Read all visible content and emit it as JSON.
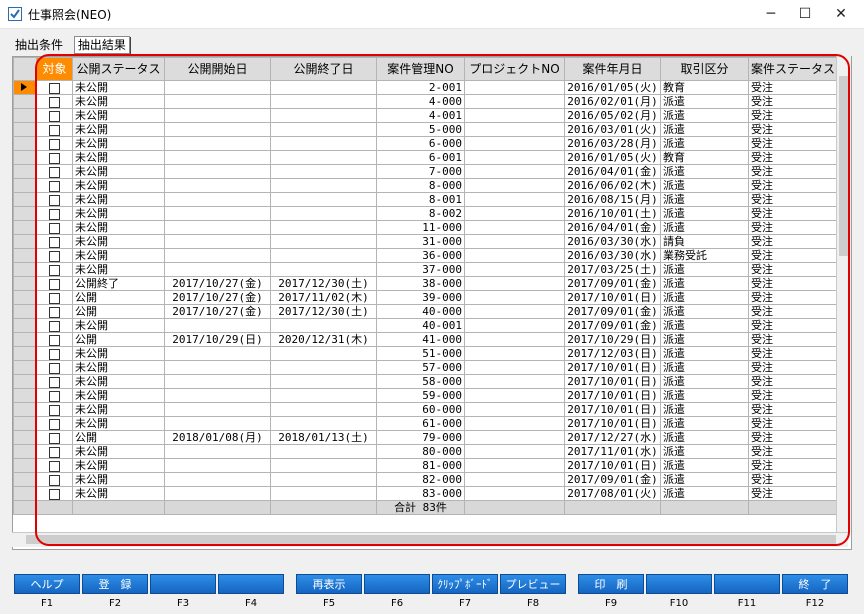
{
  "window": {
    "title": "仕事照会(NEO)",
    "minimize": "─",
    "maximize": "☐",
    "close": "✕"
  },
  "tabs": [
    "抽出条件",
    "抽出結果"
  ],
  "grid": {
    "columns": [
      "対象",
      "公開ステータス",
      "公開開始日",
      "公開終了日",
      "案件管理NO",
      "プロジェクトNO",
      "案件年月日",
      "取引区分",
      "案件ステータス"
    ],
    "rows": [
      [
        "未公開",
        "",
        "",
        "2-001",
        "",
        "2016/01/05(火)",
        "教育",
        "受注"
      ],
      [
        "未公開",
        "",
        "",
        "4-000",
        "",
        "2016/02/01(月)",
        "派遣",
        "受注"
      ],
      [
        "未公開",
        "",
        "",
        "4-001",
        "",
        "2016/05/02(月)",
        "派遣",
        "受注"
      ],
      [
        "未公開",
        "",
        "",
        "5-000",
        "",
        "2016/03/01(火)",
        "派遣",
        "受注"
      ],
      [
        "未公開",
        "",
        "",
        "6-000",
        "",
        "2016/03/28(月)",
        "派遣",
        "受注"
      ],
      [
        "未公開",
        "",
        "",
        "6-001",
        "",
        "2016/01/05(火)",
        "教育",
        "受注"
      ],
      [
        "未公開",
        "",
        "",
        "7-000",
        "",
        "2016/04/01(金)",
        "派遣",
        "受注"
      ],
      [
        "未公開",
        "",
        "",
        "8-000",
        "",
        "2016/06/02(木)",
        "派遣",
        "受注"
      ],
      [
        "未公開",
        "",
        "",
        "8-001",
        "",
        "2016/08/15(月)",
        "派遣",
        "受注"
      ],
      [
        "未公開",
        "",
        "",
        "8-002",
        "",
        "2016/10/01(土)",
        "派遣",
        "受注"
      ],
      [
        "未公開",
        "",
        "",
        "11-000",
        "",
        "2016/04/01(金)",
        "派遣",
        "受注"
      ],
      [
        "未公開",
        "",
        "",
        "31-000",
        "",
        "2016/03/30(水)",
        "請負",
        "受注"
      ],
      [
        "未公開",
        "",
        "",
        "36-000",
        "",
        "2016/03/30(水)",
        "業務受託",
        "受注"
      ],
      [
        "未公開",
        "",
        "",
        "37-000",
        "",
        "2017/03/25(土)",
        "派遣",
        "受注"
      ],
      [
        "公開終了",
        "2017/10/27(金)",
        "2017/12/30(土)",
        "38-000",
        "",
        "2017/09/01(金)",
        "派遣",
        "受注"
      ],
      [
        "公開",
        "2017/10/27(金)",
        "2017/11/02(木)",
        "39-000",
        "",
        "2017/10/01(日)",
        "派遣",
        "受注"
      ],
      [
        "公開",
        "2017/10/27(金)",
        "2017/12/30(土)",
        "40-000",
        "",
        "2017/09/01(金)",
        "派遣",
        "受注"
      ],
      [
        "未公開",
        "",
        "",
        "40-001",
        "",
        "2017/09/01(金)",
        "派遣",
        "受注"
      ],
      [
        "公開",
        "2017/10/29(日)",
        "2020/12/31(木)",
        "41-000",
        "",
        "2017/10/29(日)",
        "派遣",
        "受注"
      ],
      [
        "未公開",
        "",
        "",
        "51-000",
        "",
        "2017/12/03(日)",
        "派遣",
        "受注"
      ],
      [
        "未公開",
        "",
        "",
        "57-000",
        "",
        "2017/10/01(日)",
        "派遣",
        "受注"
      ],
      [
        "未公開",
        "",
        "",
        "58-000",
        "",
        "2017/10/01(日)",
        "派遣",
        "受注"
      ],
      [
        "未公開",
        "",
        "",
        "59-000",
        "",
        "2017/10/01(日)",
        "派遣",
        "受注"
      ],
      [
        "未公開",
        "",
        "",
        "60-000",
        "",
        "2017/10/01(日)",
        "派遣",
        "受注"
      ],
      [
        "未公開",
        "",
        "",
        "61-000",
        "",
        "2017/10/01(日)",
        "派遣",
        "受注"
      ],
      [
        "公開",
        "2018/01/08(月)",
        "2018/01/13(土)",
        "79-000",
        "",
        "2017/12/27(水)",
        "派遣",
        "受注"
      ],
      [
        "未公開",
        "",
        "",
        "80-000",
        "",
        "2017/11/01(水)",
        "派遣",
        "受注"
      ],
      [
        "未公開",
        "",
        "",
        "81-000",
        "",
        "2017/10/01(日)",
        "派遣",
        "受注"
      ],
      [
        "未公開",
        "",
        "",
        "82-000",
        "",
        "2017/09/01(金)",
        "派遣",
        "受注"
      ],
      [
        "未公開",
        "",
        "",
        "83-000",
        "",
        "2017/08/01(火)",
        "派遣",
        "受注"
      ]
    ],
    "total": "合計 83件"
  },
  "fkeys": [
    {
      "label": "ヘルプ",
      "key": "F1"
    },
    {
      "label": "登　録",
      "key": "F2"
    },
    {
      "label": "",
      "key": "F3"
    },
    {
      "label": "",
      "key": "F4"
    },
    {
      "label": "再表示",
      "key": "F5"
    },
    {
      "label": "",
      "key": "F6"
    },
    {
      "label": "ｸﾘｯﾌﾟﾎﾞｰﾄﾞ",
      "key": "F7"
    },
    {
      "label": "プレビュー",
      "key": "F8"
    },
    {
      "label": "印　刷",
      "key": "F9"
    },
    {
      "label": "",
      "key": "F10"
    },
    {
      "label": "",
      "key": "F11"
    },
    {
      "label": "終　了",
      "key": "F12"
    }
  ],
  "colors": {
    "accent": "#ff8c00",
    "outline": "#e00000",
    "fkey": "#1e7ad6"
  }
}
